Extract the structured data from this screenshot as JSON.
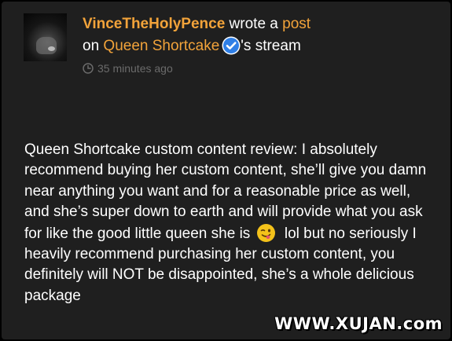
{
  "post": {
    "author": "VinceTheHolyPence",
    "verb": " wrote a ",
    "post_link": "post",
    "on": "on ",
    "stream_owner": "Queen Shortcake",
    "stream_suffix": "'s stream",
    "timestamp": "35 minutes ago",
    "body_part1": "Queen Shortcake custom content review: I absolutely recommend buying her custom content, she’ll give you damn near anything you want and for a reasonable price as well, and she’s super down to earth and will provide what you ask for like the good little queen she is",
    "body_part2": "lol but no seriously I heavily recommend purchasing her custom content, you definitely will NOT be disappointed, she’s a whole delicious package"
  },
  "icons": {
    "verified": "verified-badge-icon",
    "clock": "clock-icon",
    "emoji": "winking-tongue-emoji-icon"
  },
  "watermark": "WWW.XUJAN.com",
  "colors": {
    "background": "#1f1f1f",
    "accent": "#f2a33a",
    "verified": "#2f7fe6",
    "muted": "#6b6b6b",
    "text": "#ffffff"
  }
}
